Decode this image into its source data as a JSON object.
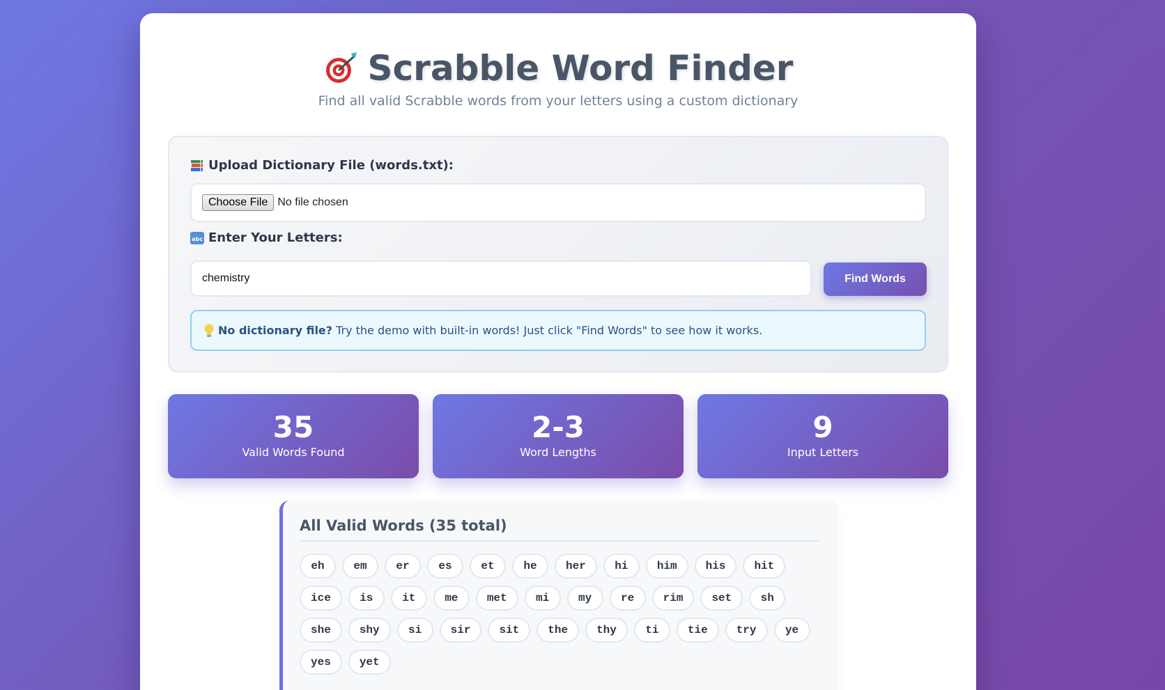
{
  "header": {
    "title": "Scrabble Word Finder",
    "subtitle": "Find all valid Scrabble words from your letters using a custom dictionary"
  },
  "upload": {
    "label": "Upload Dictionary File (words.txt):",
    "button_label": "Choose File",
    "status": "No file chosen"
  },
  "letters": {
    "label": "Enter Your Letters:",
    "value": "chemistry",
    "button_label": "Find Words"
  },
  "hint": {
    "bold": "No dictionary file?",
    "text": "Try the demo with built-in words! Just click \"Find Words\" to see how it works."
  },
  "stats": [
    {
      "value": "35",
      "label": "Valid Words Found"
    },
    {
      "value": "2-3",
      "label": "Word Lengths"
    },
    {
      "value": "9",
      "label": "Input Letters"
    }
  ],
  "results": {
    "title": "All Valid Words (35 total)",
    "words": [
      "eh",
      "em",
      "er",
      "es",
      "et",
      "he",
      "her",
      "hi",
      "him",
      "his",
      "hit",
      "ice",
      "is",
      "it",
      "me",
      "met",
      "mi",
      "my",
      "re",
      "rim",
      "set",
      "sh",
      "she",
      "shy",
      "si",
      "sir",
      "sit",
      "the",
      "thy",
      "ti",
      "tie",
      "try",
      "ye",
      "yes",
      "yet"
    ]
  },
  "icons": {
    "title": "target-icon",
    "upload": "books-icon",
    "letters": "abc-icon",
    "hint": "lightbulb-icon"
  },
  "colors": {
    "accent_start": "#6e78e3",
    "accent_end": "#7a4caa"
  }
}
